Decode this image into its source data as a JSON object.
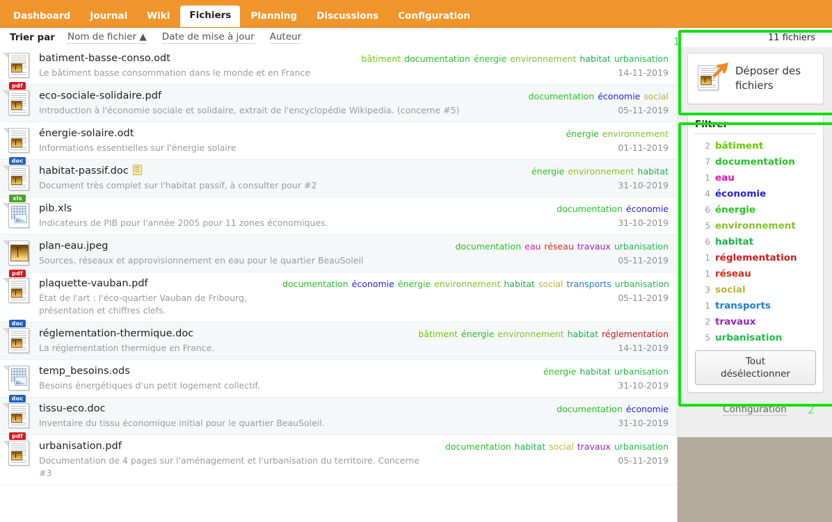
{
  "nav": {
    "tabs": [
      {
        "label": "Dashboard",
        "active": false
      },
      {
        "label": "Journal",
        "active": false
      },
      {
        "label": "Wiki",
        "active": false
      },
      {
        "label": "Fichiers",
        "active": true
      },
      {
        "label": "Planning",
        "active": false
      },
      {
        "label": "Discussions",
        "active": false
      },
      {
        "label": "Configuration",
        "active": false
      }
    ]
  },
  "sortbar": {
    "label": "Trier par",
    "links": [
      "Nom de fichier ▲",
      "Date de mise à jour",
      "Auteur"
    ],
    "count": "11 fichiers"
  },
  "tag_colors": {
    "bâtiment": "#66cc00",
    "documentation": "#22c522",
    "eau": "#e215a8",
    "économie": "#2323e0",
    "énergie": "#26c426",
    "environnement": "#7ec427",
    "habitat": "#1ab24a",
    "réglementation": "#d01b1b",
    "réseau": "#d62c12",
    "social": "#bcb433",
    "transports": "#1a7fd4",
    "travaux": "#9b21c9",
    "urbanisation": "#1fbe4a"
  },
  "files": [
    {
      "name": "batiment-basse-conso.odt",
      "desc": "Le bâtiment basse consommation dans le monde et en France",
      "tags": [
        "bâtiment",
        "documentation",
        "énergie",
        "environnement",
        "habitat",
        "urbanisation"
      ],
      "date": "14-11-2019",
      "icon": "doc-plain",
      "badge": "",
      "note": false
    },
    {
      "name": "eco-sociale-solidaire.pdf",
      "desc": "Introduction à l'économie sociale et solidaire, extrait de l'encyclopédie Wikipedia. (concerne #5)",
      "tags": [
        "documentation",
        "économie",
        "social"
      ],
      "date": "05-11-2019",
      "icon": "doc-badge",
      "badge": "pdf",
      "note": false
    },
    {
      "name": "énergie-solaire.odt",
      "desc": "Informations essentielles sur l'énergie solaire",
      "tags": [
        "énergie",
        "environnement"
      ],
      "date": "01-11-2019",
      "icon": "doc-plain",
      "badge": "",
      "note": false
    },
    {
      "name": "habitat-passif.doc",
      "desc": "Document très complet sur l'habitat passif, à consulter pour #2",
      "tags": [
        "énergie",
        "environnement",
        "habitat"
      ],
      "date": "31-10-2019",
      "icon": "doc-badge",
      "badge": "doc",
      "note": true
    },
    {
      "name": "pib.xls",
      "desc": "Indicateurs de PIB pour l'année 2005 pour 11 zones économiques.",
      "tags": [
        "documentation",
        "économie"
      ],
      "date": "31-10-2019",
      "icon": "sheet",
      "badge": "xls",
      "note": false
    },
    {
      "name": "plan-eau.jpeg",
      "desc": "Sources, réseaux et approvisionnement en eau pour le quartier BeauSoleil",
      "tags": [
        "documentation",
        "eau",
        "réseau",
        "travaux",
        "urbanisation"
      ],
      "date": "05-11-2019",
      "icon": "photo",
      "badge": "",
      "note": false
    },
    {
      "name": "plaquette-vauban.pdf",
      "desc": "État de l'art : l'éco-quartier Vauban de Fribourg, présentation et chiffres clefs.",
      "tags": [
        "documentation",
        "économie",
        "énergie",
        "environnement",
        "habitat",
        "social",
        "transports",
        "urbanisation"
      ],
      "date": "05-11-2019",
      "icon": "doc-badge",
      "badge": "pdf",
      "note": false
    },
    {
      "name": "réglementation-thermique.doc",
      "desc": "La réglementation thermique en France.",
      "tags": [
        "bâtiment",
        "énergie",
        "environnement",
        "habitat",
        "réglementation"
      ],
      "date": "14-11-2019",
      "icon": "doc-badge",
      "badge": "doc",
      "note": false
    },
    {
      "name": "temp_besoins.ods",
      "desc": "Besoins énergétiques d'un petit logement collectif.",
      "tags": [
        "énergie",
        "habitat",
        "urbanisation"
      ],
      "date": "31-10-2019",
      "icon": "sheet",
      "badge": "",
      "note": false
    },
    {
      "name": "tissu-eco.doc",
      "desc": "Inventaire du tissu économique initial pour le quartier BeauSoleil.",
      "tags": [
        "documentation",
        "économie"
      ],
      "date": "31-10-2019",
      "icon": "doc-badge",
      "badge": "doc",
      "note": false
    },
    {
      "name": "urbanisation.pdf",
      "desc": "Documentation de 4 pages sur l'aménagement et l'urbanisation du territoire. Concerne #3",
      "tags": [
        "documentation",
        "habitat",
        "social",
        "travaux",
        "urbanisation"
      ],
      "date": "05-11-2019",
      "icon": "doc-badge",
      "badge": "pdf",
      "note": false
    }
  ],
  "sidebar": {
    "dropbox_label": "Déposer des fichiers",
    "filter_title": "Filtrer",
    "filters": [
      {
        "count": "2",
        "name": "bâtiment"
      },
      {
        "count": "7",
        "name": "documentation"
      },
      {
        "count": "1",
        "name": "eau"
      },
      {
        "count": "4",
        "name": "économie"
      },
      {
        "count": "6",
        "name": "énergie"
      },
      {
        "count": "5",
        "name": "environnement"
      },
      {
        "count": "6",
        "name": "habitat"
      },
      {
        "count": "1",
        "name": "réglementation"
      },
      {
        "count": "1",
        "name": "réseau"
      },
      {
        "count": "3",
        "name": "social"
      },
      {
        "count": "1",
        "name": "transports"
      },
      {
        "count": "2",
        "name": "travaux"
      },
      {
        "count": "5",
        "name": "urbanisation"
      }
    ],
    "deselect_label": "Tout\ndésélectionner",
    "config_label": "Configuration"
  },
  "annotations": [
    {
      "id": "1",
      "label": "1"
    },
    {
      "id": "2",
      "label": "2"
    }
  ]
}
